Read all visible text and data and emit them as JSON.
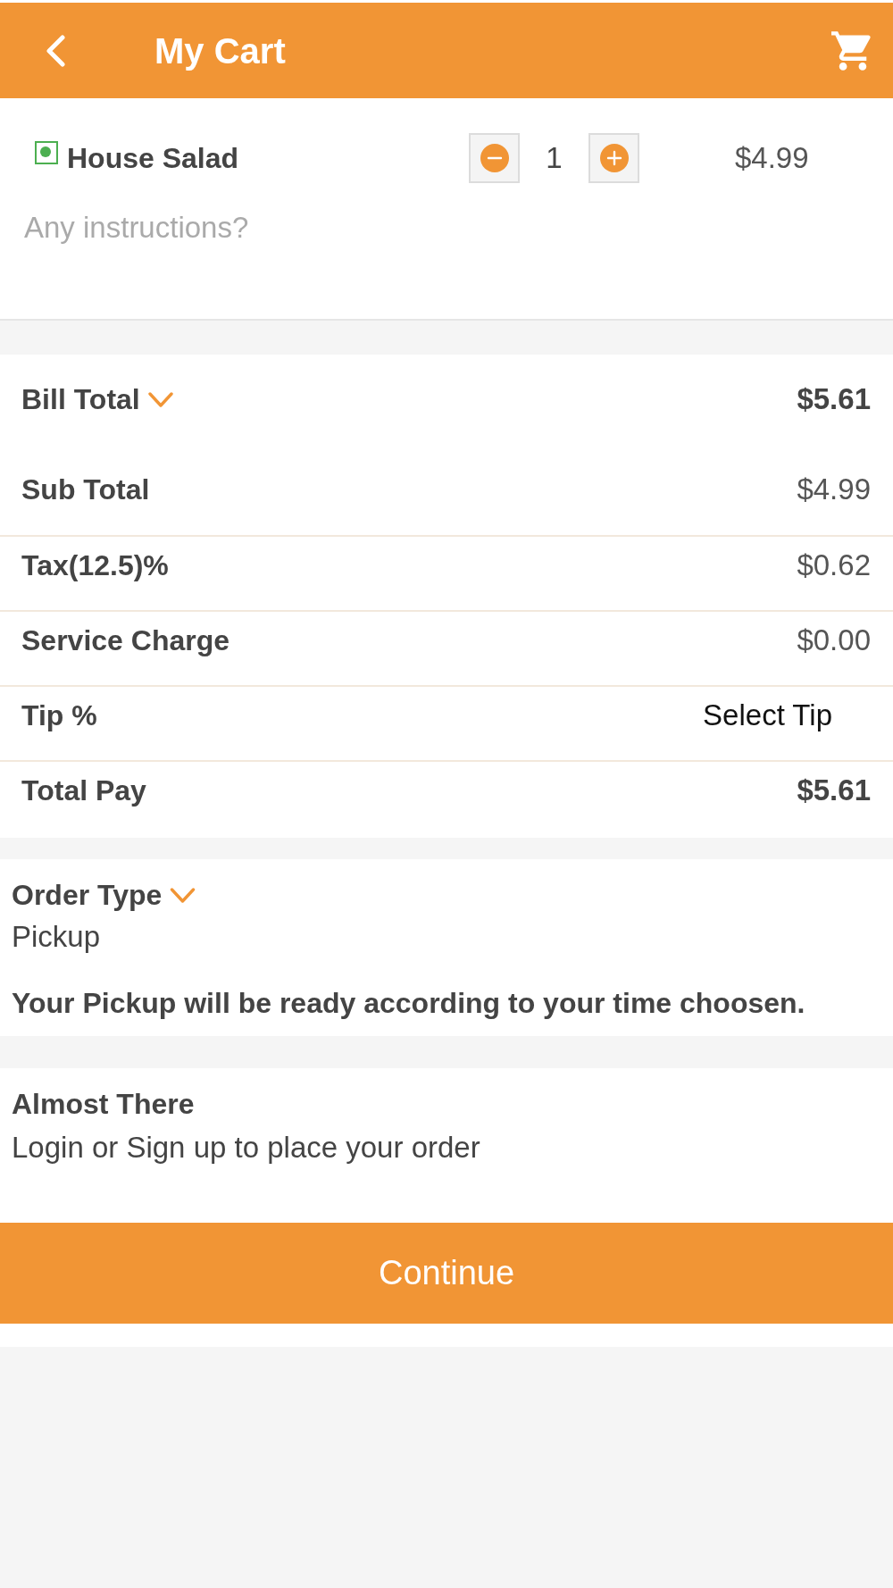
{
  "header": {
    "title": "My Cart"
  },
  "cart_items": [
    {
      "name": "House Salad",
      "veg": true,
      "quantity": "1",
      "price": "$4.99",
      "instructions": {
        "placeholder": "Any instructions?"
      }
    }
  ],
  "bill": {
    "title": "Bill Total",
    "total": "$5.61",
    "rows": [
      {
        "kind": "amount",
        "label": "Sub Total",
        "value": "$4.99"
      },
      {
        "kind": "amount",
        "label": "Tax(12.5)%",
        "value": "$0.62"
      },
      {
        "kind": "amount",
        "label": "Service Charge",
        "value": "$0.00"
      },
      {
        "kind": "select",
        "label": "Tip %",
        "value": "Select Tip"
      },
      {
        "kind": "total",
        "label": "Total Pay",
        "value": "$5.61"
      }
    ]
  },
  "order_type": {
    "title": "Order Type",
    "value": "Pickup",
    "note": "Your Pickup will be ready according to your time choosen."
  },
  "login_prompt": {
    "title": "Almost There",
    "text": "Login or Sign up to place your order"
  },
  "continue_button": {
    "label": "Continue"
  }
}
